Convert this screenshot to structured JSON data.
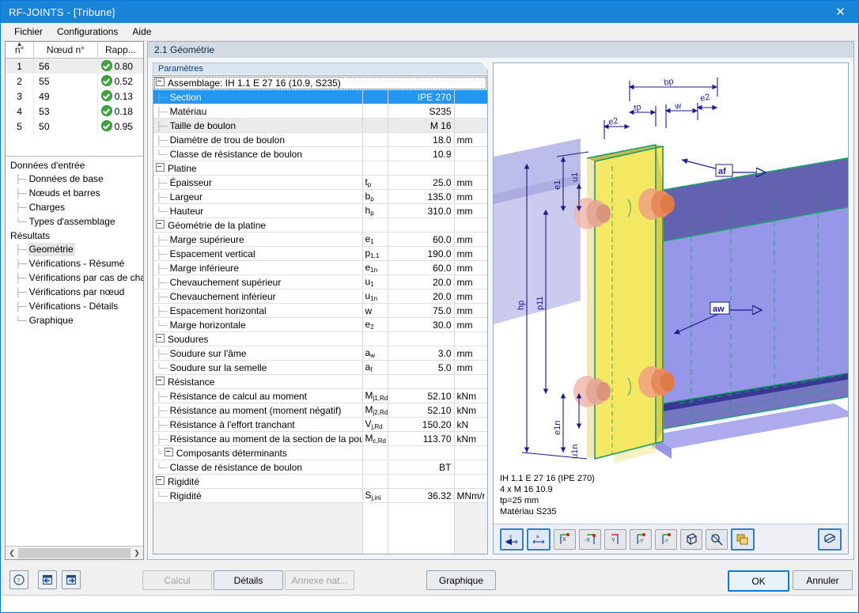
{
  "window": {
    "title": "RF-JOINTS - [Tribune]",
    "close_icon": "close-icon"
  },
  "menu": {
    "items": [
      "Fichier",
      "Configurations",
      "Aide"
    ]
  },
  "node_table": {
    "columns": [
      "n°",
      "Nœud n°",
      "Rapp..."
    ],
    "rows": [
      {
        "n": "1",
        "node": "56",
        "ratio": "0.80",
        "status": "ok"
      },
      {
        "n": "2",
        "node": "55",
        "ratio": "0.52",
        "status": "ok"
      },
      {
        "n": "3",
        "node": "49",
        "ratio": "0.13",
        "status": "ok"
      },
      {
        "n": "4",
        "node": "53",
        "ratio": "0.18",
        "status": "ok"
      },
      {
        "n": "5",
        "node": "50",
        "ratio": "0.95",
        "status": "ok"
      }
    ]
  },
  "tree": {
    "groups": [
      {
        "label": "Données d'entrée",
        "children": [
          "Données de base",
          "Nœuds et barres",
          "Charges",
          "Types d'assemblage"
        ]
      },
      {
        "label": "Résultats",
        "children": [
          "Geométrie",
          "Vérifications - Résumé",
          "Vérifications par cas de charge",
          "Vérifications par nœud",
          "Vérifications - Détails",
          "Graphique"
        ]
      }
    ],
    "active": "Geométrie"
  },
  "tab": {
    "title": "2.1 Géométrie"
  },
  "params": {
    "group_header": "Paramètres",
    "root": "Assemblage: IH 1.1 E 27 16 (10.9, S235)",
    "rows": [
      {
        "type": "root",
        "label": "Assemblage: IH 1.1 E 27 16 (10.9, S235)",
        "sym": "",
        "val": "",
        "unit": ""
      },
      {
        "type": "item",
        "label": "Section",
        "sym": "",
        "val": "IPE 270",
        "unit": "",
        "selected": true
      },
      {
        "type": "item",
        "label": "Matériau",
        "sym": "",
        "val": "S235",
        "unit": ""
      },
      {
        "type": "item",
        "label": "Taille de boulon",
        "sym": "",
        "val": "M 16",
        "unit": "",
        "alt": true
      },
      {
        "type": "item",
        "label": "Diamètre de trou de boulon",
        "sym": "",
        "val": "18.0",
        "unit": "mm"
      },
      {
        "type": "item",
        "label": "Classe de résistance de boulon",
        "sym": "",
        "val": "10.9",
        "unit": ""
      },
      {
        "type": "group",
        "label": "Platine",
        "sym": "",
        "val": "",
        "unit": ""
      },
      {
        "type": "item",
        "label": "Épaisseur",
        "sym": "t|p",
        "val": "25.0",
        "unit": "mm"
      },
      {
        "type": "item",
        "label": "Largeur",
        "sym": "b|p",
        "val": "135.0",
        "unit": "mm"
      },
      {
        "type": "item",
        "label": "Hauteur",
        "sym": "h|p",
        "val": "310.0",
        "unit": "mm"
      },
      {
        "type": "group",
        "label": "Géométrie de la platine",
        "sym": "",
        "val": "",
        "unit": ""
      },
      {
        "type": "item",
        "label": "Marge supérieure",
        "sym": "e|1",
        "val": "60.0",
        "unit": "mm"
      },
      {
        "type": "item",
        "label": "Espacement vertical",
        "sym": "p|1,1",
        "val": "190.0",
        "unit": "mm"
      },
      {
        "type": "item",
        "label": "Marge inférieure",
        "sym": "e|1n",
        "val": "60.0",
        "unit": "mm"
      },
      {
        "type": "item",
        "label": "Chevauchement supérieur",
        "sym": "u|1",
        "val": "20.0",
        "unit": "mm"
      },
      {
        "type": "item",
        "label": "Chevauchement inférieur",
        "sym": "u|1n",
        "val": "20.0",
        "unit": "mm"
      },
      {
        "type": "item",
        "label": "Espacement horizontal",
        "sym": "w|",
        "val": "75.0",
        "unit": "mm"
      },
      {
        "type": "item",
        "label": "Marge horizontale",
        "sym": "e|2",
        "val": "30.0",
        "unit": "mm"
      },
      {
        "type": "group",
        "label": "Soudures",
        "sym": "",
        "val": "",
        "unit": ""
      },
      {
        "type": "item",
        "label": "Soudure sur l'âme",
        "sym": "a|w",
        "val": "3.0",
        "unit": "mm"
      },
      {
        "type": "item",
        "label": "Soudure sur la semelle",
        "sym": "a|f",
        "val": "5.0",
        "unit": "mm"
      },
      {
        "type": "group",
        "label": "Résistance",
        "sym": "",
        "val": "",
        "unit": ""
      },
      {
        "type": "item",
        "label": "Résistance de calcul au moment",
        "sym": "M|j1,Rd",
        "val": "52.10",
        "unit": "kNm"
      },
      {
        "type": "item",
        "label": "Résistance au moment (moment négatif)",
        "sym": "M|j2,Rd",
        "val": "52.10",
        "unit": "kNm"
      },
      {
        "type": "item",
        "label": "Résistance à l'effort tranchant",
        "sym": "V|j,Rd",
        "val": "150.20",
        "unit": "kN"
      },
      {
        "type": "item",
        "label": "Résistance au moment de la section de la poutre",
        "sym": "M|c,Rd",
        "val": "113.70",
        "unit": "kNm"
      },
      {
        "type": "subgroup",
        "label": "Composants déterminants",
        "sym": "",
        "val": "",
        "unit": ""
      },
      {
        "type": "item3",
        "label": "Classe de résistance de boulon",
        "sym": "",
        "val": "BT",
        "unit": ""
      },
      {
        "type": "group",
        "label": "Rigidité",
        "sym": "",
        "val": "",
        "unit": ""
      },
      {
        "type": "item",
        "label": "Rigidité",
        "sym": "S|j,ini",
        "val": "36.32",
        "unit": "MNm/r"
      }
    ]
  },
  "graphic": {
    "caption": [
      "IH 1.1 E 27 16  (IPE 270)",
      "4 x M 16 10.9",
      "tp=25 mm",
      "Matériau S235"
    ],
    "dimension_labels": [
      "bp",
      "tp",
      "w",
      "e2",
      "e2",
      "u1",
      "e1",
      "hp",
      "p11",
      "e1n",
      "u1n",
      "af",
      "aw"
    ],
    "toolbar": [
      {
        "name": "dim-x-button",
        "label": "x",
        "active": true
      },
      {
        "name": "dim-a-button",
        "label": "a",
        "active": true
      },
      {
        "name": "view-x-button",
        "label": "X",
        "active": false
      },
      {
        "name": "view-minus-x-button",
        "label": "-X",
        "active": false
      },
      {
        "name": "view-y-button",
        "label": "Y",
        "active": false
      },
      {
        "name": "view-minus-y2-button",
        "label": "-Y'",
        "active": false
      },
      {
        "name": "view-minus-y-button",
        "label": "-Y",
        "active": false
      },
      {
        "name": "isometric-button",
        "label": "cube",
        "active": false
      },
      {
        "name": "zoom-all-button",
        "label": "zoom",
        "active": false
      },
      {
        "name": "render-mode-button",
        "label": "layers",
        "active": true
      },
      {
        "name": "print-button",
        "label": "print",
        "active": true
      }
    ]
  },
  "footer": {
    "help_icon": "help-icon",
    "prev_icon": "previous-icon",
    "next_icon": "next-icon",
    "calcul": "Calcul",
    "details": "Détails",
    "annexe": "Annexe nat...",
    "graphique": "Graphique",
    "ok": "OK",
    "annuler": "Annuler"
  },
  "colors": {
    "accent": "#1883d7",
    "selection": "#2196f3",
    "status_ok": "#3fa63f",
    "plate": "#f2e85c",
    "beam": "#8f8fe8"
  }
}
